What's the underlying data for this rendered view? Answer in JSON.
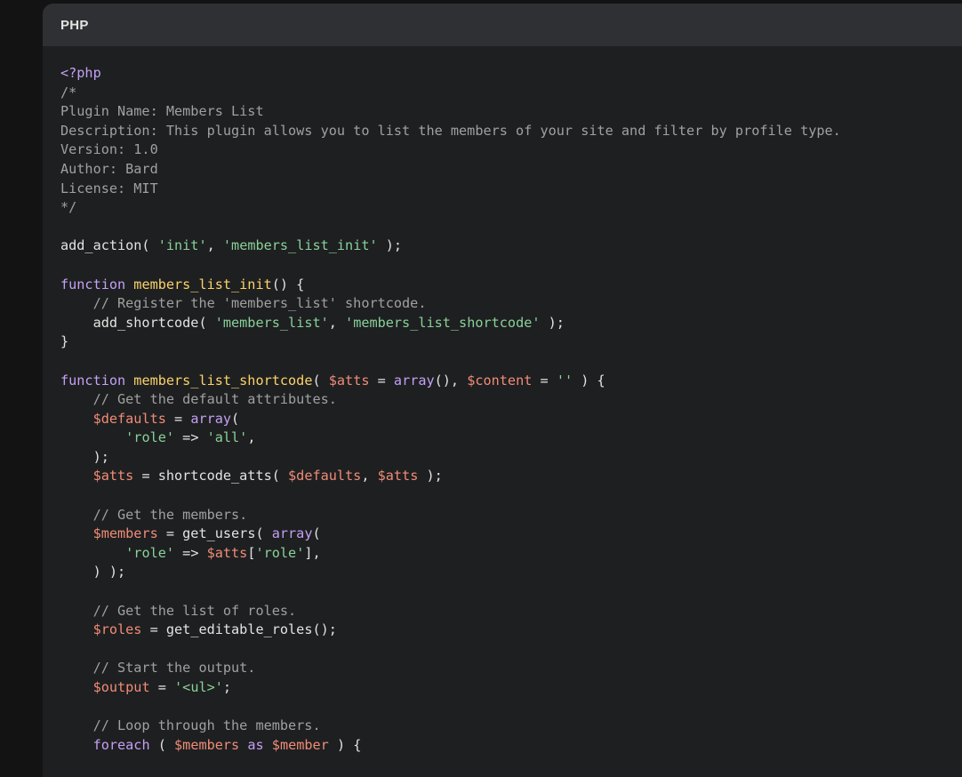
{
  "header": {
    "language": "PHP"
  },
  "colors": {
    "default": "#e3e3e3",
    "comment": "#a0a0a0",
    "keyword": "#c3a0f5",
    "function": "#fbd36a",
    "string": "#88d19a",
    "variable": "#f08c78"
  },
  "code_lines": [
    [
      {
        "t": "<?php",
        "c": "tag"
      }
    ],
    [
      {
        "t": "/*",
        "c": "comment"
      }
    ],
    [
      {
        "t": "Plugin Name: Members List",
        "c": "comment"
      }
    ],
    [
      {
        "t": "Description: This plugin allows you to list the members of your site and filter by profile type.",
        "c": "comment"
      }
    ],
    [
      {
        "t": "Version: 1.0",
        "c": "comment"
      }
    ],
    [
      {
        "t": "Author: Bard",
        "c": "comment"
      }
    ],
    [
      {
        "t": "License: MIT",
        "c": "comment"
      }
    ],
    [
      {
        "t": "*/",
        "c": "comment"
      }
    ],
    [],
    [
      {
        "t": "add_action( ",
        "c": "default"
      },
      {
        "t": "'init'",
        "c": "string"
      },
      {
        "t": ", ",
        "c": "default"
      },
      {
        "t": "'members_list_init'",
        "c": "string"
      },
      {
        "t": " );",
        "c": "default"
      }
    ],
    [],
    [
      {
        "t": "function ",
        "c": "keyword"
      },
      {
        "t": "members_list_init",
        "c": "function"
      },
      {
        "t": "() {",
        "c": "default"
      }
    ],
    [
      {
        "t": "    // Register the 'members_list' shortcode.",
        "c": "comment"
      }
    ],
    [
      {
        "t": "    add_shortcode( ",
        "c": "default"
      },
      {
        "t": "'members_list'",
        "c": "string"
      },
      {
        "t": ", ",
        "c": "default"
      },
      {
        "t": "'members_list_shortcode'",
        "c": "string"
      },
      {
        "t": " );",
        "c": "default"
      }
    ],
    [
      {
        "t": "}",
        "c": "default"
      }
    ],
    [],
    [
      {
        "t": "function ",
        "c": "keyword"
      },
      {
        "t": "members_list_shortcode",
        "c": "function"
      },
      {
        "t": "( ",
        "c": "default"
      },
      {
        "t": "$atts",
        "c": "variable"
      },
      {
        "t": " = ",
        "c": "default"
      },
      {
        "t": "array",
        "c": "keyword"
      },
      {
        "t": "(), ",
        "c": "default"
      },
      {
        "t": "$content",
        "c": "variable"
      },
      {
        "t": " = ",
        "c": "default"
      },
      {
        "t": "''",
        "c": "string"
      },
      {
        "t": " ) {",
        "c": "default"
      }
    ],
    [
      {
        "t": "    // Get the default attributes.",
        "c": "comment"
      }
    ],
    [
      {
        "t": "    ",
        "c": "default"
      },
      {
        "t": "$defaults",
        "c": "variable"
      },
      {
        "t": " = ",
        "c": "default"
      },
      {
        "t": "array",
        "c": "keyword"
      },
      {
        "t": "(",
        "c": "default"
      }
    ],
    [
      {
        "t": "        ",
        "c": "default"
      },
      {
        "t": "'role'",
        "c": "string"
      },
      {
        "t": " => ",
        "c": "default"
      },
      {
        "t": "'all'",
        "c": "string"
      },
      {
        "t": ",",
        "c": "default"
      }
    ],
    [
      {
        "t": "    );",
        "c": "default"
      }
    ],
    [
      {
        "t": "    ",
        "c": "default"
      },
      {
        "t": "$atts",
        "c": "variable"
      },
      {
        "t": " = shortcode_atts( ",
        "c": "default"
      },
      {
        "t": "$defaults",
        "c": "variable"
      },
      {
        "t": ", ",
        "c": "default"
      },
      {
        "t": "$atts",
        "c": "variable"
      },
      {
        "t": " );",
        "c": "default"
      }
    ],
    [],
    [
      {
        "t": "    // Get the members.",
        "c": "comment"
      }
    ],
    [
      {
        "t": "    ",
        "c": "default"
      },
      {
        "t": "$members",
        "c": "variable"
      },
      {
        "t": " = get_users( ",
        "c": "default"
      },
      {
        "t": "array",
        "c": "keyword"
      },
      {
        "t": "(",
        "c": "default"
      }
    ],
    [
      {
        "t": "        ",
        "c": "default"
      },
      {
        "t": "'role'",
        "c": "string"
      },
      {
        "t": " => ",
        "c": "default"
      },
      {
        "t": "$atts",
        "c": "variable"
      },
      {
        "t": "[",
        "c": "default"
      },
      {
        "t": "'role'",
        "c": "string"
      },
      {
        "t": "],",
        "c": "default"
      }
    ],
    [
      {
        "t": "    ) );",
        "c": "default"
      }
    ],
    [],
    [
      {
        "t": "    // Get the list of roles.",
        "c": "comment"
      }
    ],
    [
      {
        "t": "    ",
        "c": "default"
      },
      {
        "t": "$roles",
        "c": "variable"
      },
      {
        "t": " = get_editable_roles();",
        "c": "default"
      }
    ],
    [],
    [
      {
        "t": "    // Start the output.",
        "c": "comment"
      }
    ],
    [
      {
        "t": "    ",
        "c": "default"
      },
      {
        "t": "$output",
        "c": "variable"
      },
      {
        "t": " = ",
        "c": "default"
      },
      {
        "t": "'<ul>'",
        "c": "string"
      },
      {
        "t": ";",
        "c": "default"
      }
    ],
    [],
    [
      {
        "t": "    // Loop through the members.",
        "c": "comment"
      }
    ],
    [
      {
        "t": "    ",
        "c": "default"
      },
      {
        "t": "foreach",
        "c": "keyword"
      },
      {
        "t": " ( ",
        "c": "default"
      },
      {
        "t": "$members",
        "c": "variable"
      },
      {
        "t": " ",
        "c": "default"
      },
      {
        "t": "as",
        "c": "keyword"
      },
      {
        "t": " ",
        "c": "default"
      },
      {
        "t": "$member",
        "c": "variable"
      },
      {
        "t": " ) {",
        "c": "default"
      }
    ]
  ]
}
